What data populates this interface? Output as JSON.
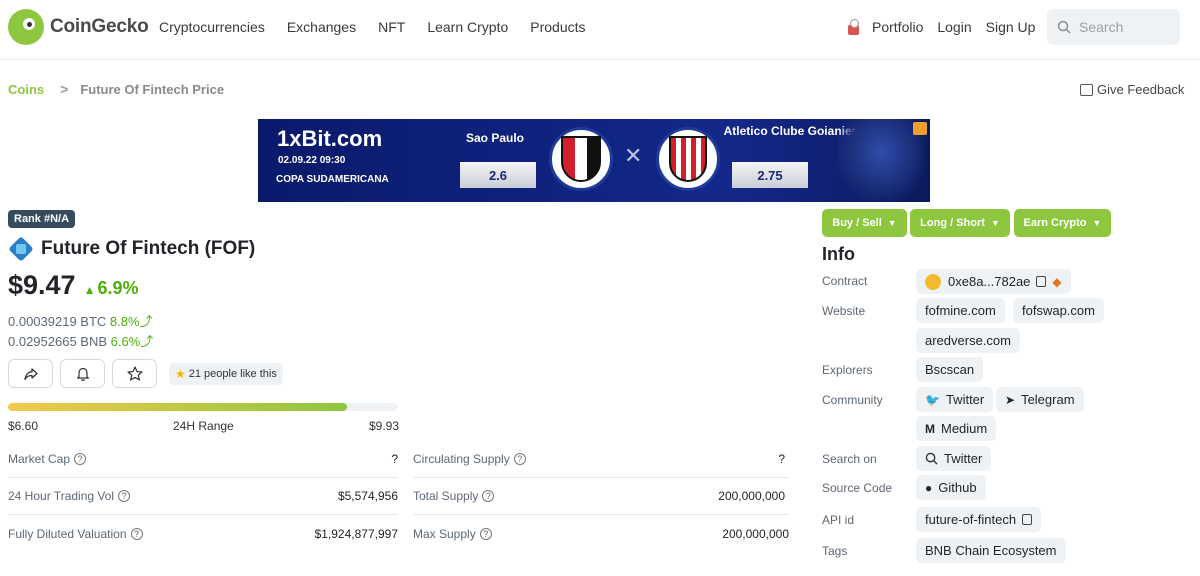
{
  "header": {
    "logo_text": "CoinGecko",
    "nav": [
      "Cryptocurrencies",
      "Exchanges",
      "NFT",
      "Learn Crypto",
      "Products"
    ],
    "portfolio": "Portfolio",
    "login": "Login",
    "signup": "Sign Up",
    "search_placeholder": "Search"
  },
  "breadcrumb": {
    "coins": "Coins",
    "separator": ">",
    "current": "Future Of Fintech Price"
  },
  "feedback": "Give Feedback",
  "ad": {
    "brand": "1xBit.com",
    "date": "02.09.22 09:30",
    "league": "COPA SUDAMERICANA",
    "team1": "Sao Paulo",
    "odd1": "2.6",
    "vs": "✕",
    "team2": "Atletico Clube Goianiense",
    "odd2": "2.75"
  },
  "coin": {
    "rank": "Rank #N/A",
    "name": "Future Of Fintech (FOF)",
    "price": "$9.47",
    "change": "6.9%",
    "btc_price": "0.00039219 BTC",
    "btc_change": "8.8%",
    "bnb_price": "0.02952665 BNB",
    "bnb_change": "6.6%",
    "likes": "21 people like this",
    "range_low": "$6.60",
    "range_label": "24H Range",
    "range_high": "$9.93",
    "range_position": 0.87
  },
  "stats_left": [
    {
      "label": "Market Cap",
      "value": "?"
    },
    {
      "label": "24 Hour Trading Vol",
      "value": "$5,574,956"
    },
    {
      "label": "Fully Diluted Valuation",
      "value": "$1,924,877,997"
    }
  ],
  "stats_right": [
    {
      "label": "Circulating Supply",
      "value": "?"
    },
    {
      "label": "Total Supply",
      "value": "200,000,000"
    },
    {
      "label": "Max Supply",
      "value": "200,000,000"
    }
  ],
  "actions": {
    "buy_sell": "Buy / Sell",
    "long_short": "Long / Short",
    "earn": "Earn Crypto"
  },
  "info": {
    "title": "Info",
    "contract_label": "Contract",
    "contract": "0xe8a...782ae",
    "website_label": "Website",
    "websites": [
      "fofmine.com",
      "fofswap.com",
      "aredverse.com"
    ],
    "explorers_label": "Explorers",
    "explorer": "Bscscan",
    "community_label": "Community",
    "community": [
      "Twitter",
      "Telegram",
      "Medium"
    ],
    "search_label": "Search on",
    "search_on": "Twitter",
    "source_label": "Source Code",
    "source": "Github",
    "api_label": "API id",
    "api_id": "future-of-fintech",
    "tags_label": "Tags",
    "tag": "BNB Chain Ecosystem"
  },
  "colors": {
    "brand_green": "#8dc63f",
    "up_green": "#4eaf0a"
  }
}
